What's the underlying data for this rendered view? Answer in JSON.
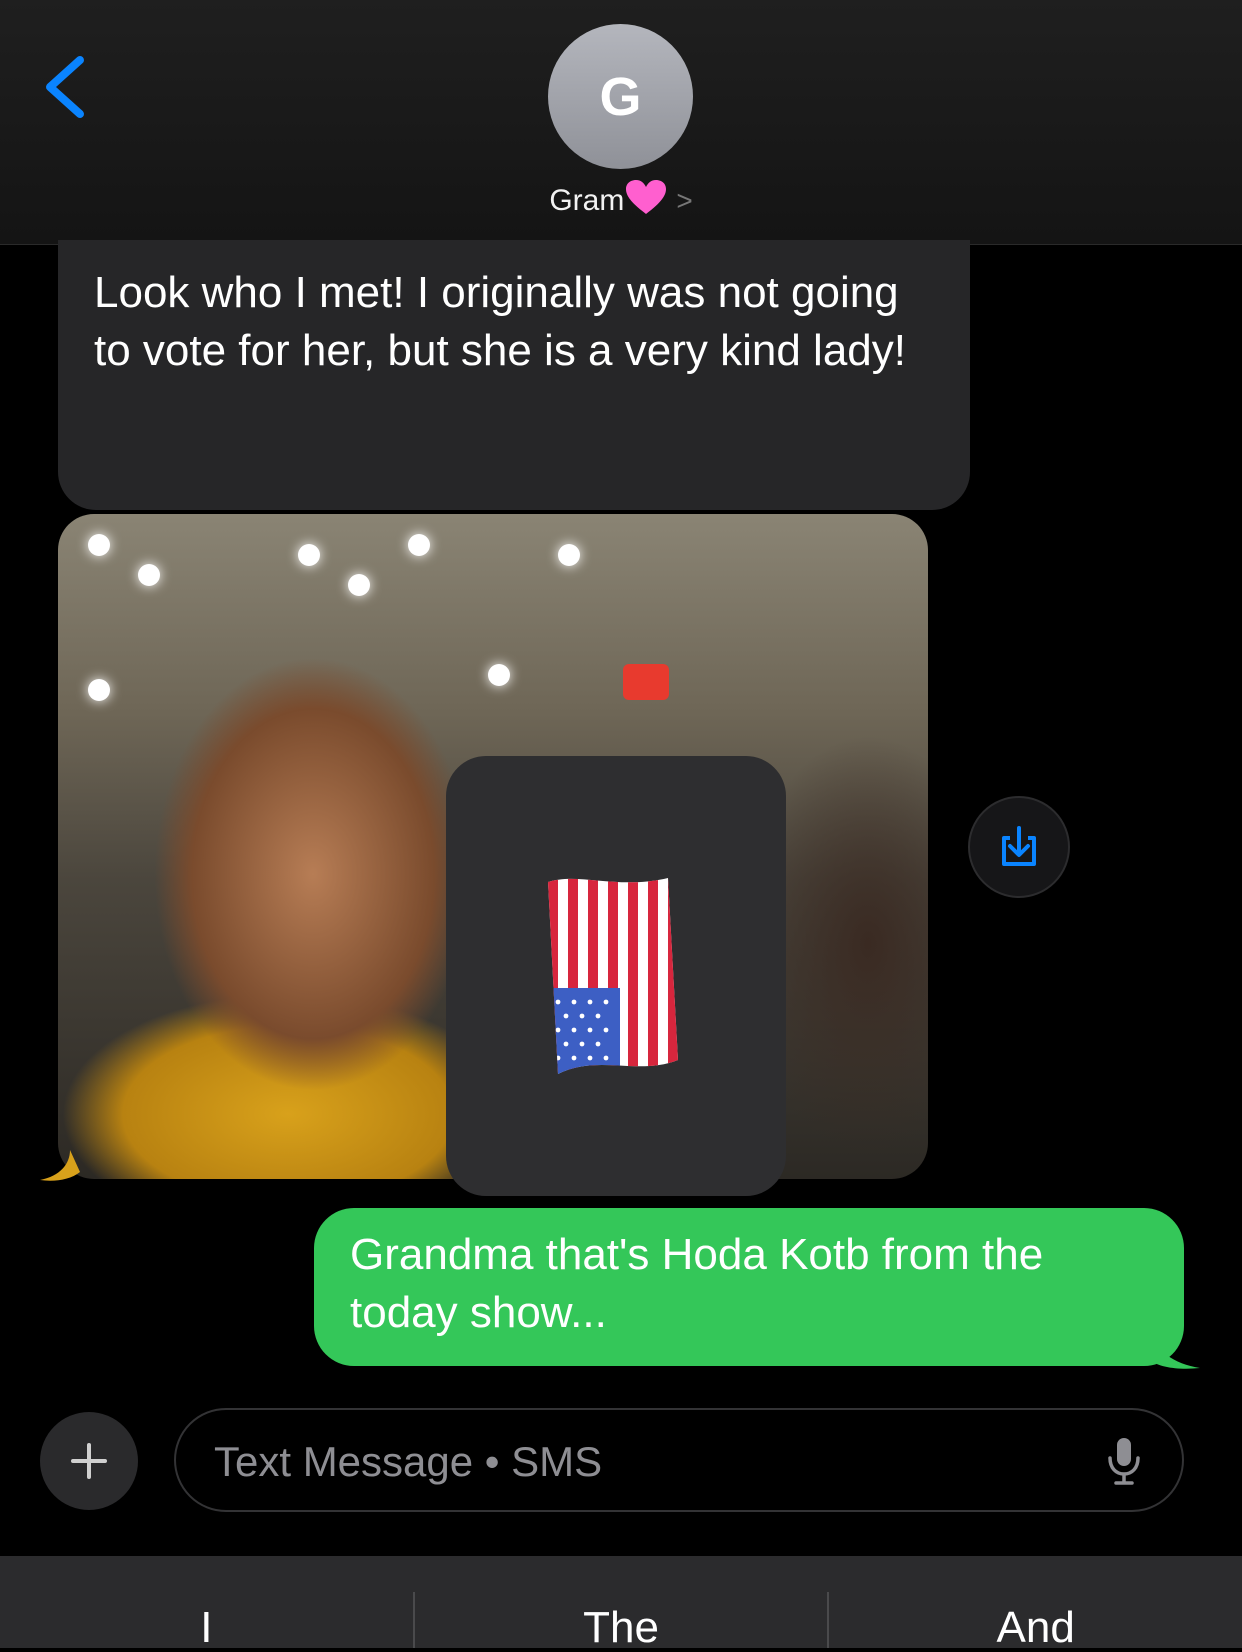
{
  "header": {
    "avatar_initial": "G",
    "contact_name": "Gram",
    "contact_emoji": "heart-icon",
    "chevron": ">"
  },
  "messages": [
    {
      "direction": "incoming",
      "type": "text",
      "text": "Look who I met! I originally was not going to vote for her, but she is a very kind lady!"
    },
    {
      "direction": "incoming",
      "type": "photo",
      "sticker": "us-flag-icon"
    },
    {
      "direction": "outgoing",
      "type": "text",
      "text": "Grandma that's Hoda Kotb from the today show..."
    }
  ],
  "composer": {
    "placeholder": "Text Message • SMS"
  },
  "suggestions": [
    "I",
    "The",
    "And"
  ],
  "colors": {
    "outgoing_bubble": "#34c759",
    "incoming_bubble": "#262628",
    "accent": "#0a84ff"
  }
}
